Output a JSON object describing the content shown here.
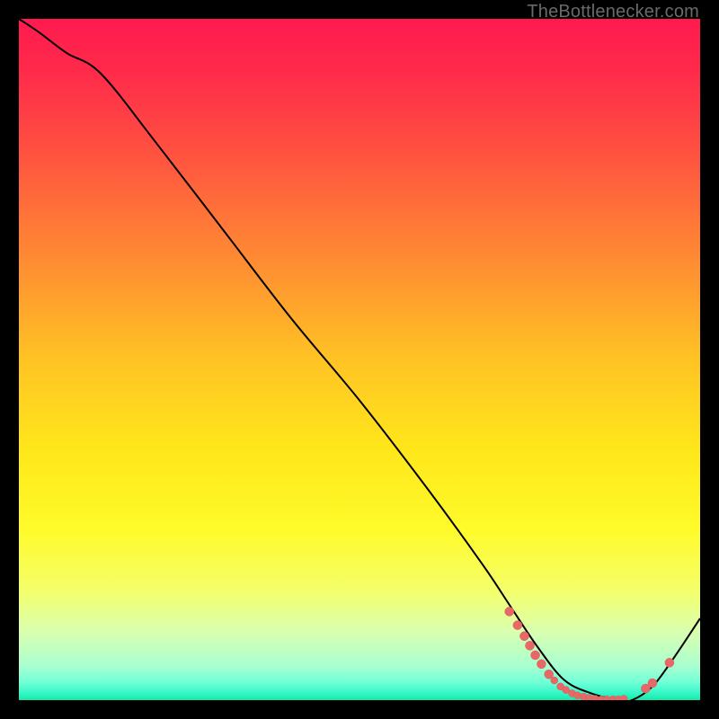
{
  "watermark": "TheBottlenecker.com",
  "colors": {
    "black": "#000000",
    "curve": "#000000",
    "marker_fill": "#e86868",
    "marker_stroke": "#d85a5a",
    "gradient_stops": [
      {
        "offset": 0.0,
        "color": "#ff1a4e"
      },
      {
        "offset": 0.08,
        "color": "#ff2b4a"
      },
      {
        "offset": 0.2,
        "color": "#ff5340"
      },
      {
        "offset": 0.35,
        "color": "#ff8a33"
      },
      {
        "offset": 0.5,
        "color": "#ffc324"
      },
      {
        "offset": 0.63,
        "color": "#ffe61b"
      },
      {
        "offset": 0.75,
        "color": "#fffb2a"
      },
      {
        "offset": 0.84,
        "color": "#f4ff6b"
      },
      {
        "offset": 0.9,
        "color": "#d9ffb0"
      },
      {
        "offset": 0.95,
        "color": "#a9ffd0"
      },
      {
        "offset": 0.975,
        "color": "#6dffd7"
      },
      {
        "offset": 0.99,
        "color": "#33f7c6"
      },
      {
        "offset": 1.0,
        "color": "#18e8a8"
      }
    ]
  },
  "chart_data": {
    "type": "line",
    "title": "",
    "xlabel": "",
    "ylabel": "",
    "xlim": [
      0,
      100
    ],
    "ylim": [
      0,
      100
    ],
    "series": [
      {
        "name": "bottleneck-curve",
        "x": [
          0,
          3,
          7,
          12,
          20,
          30,
          40,
          50,
          60,
          68,
          72,
          76,
          80,
          84,
          88,
          90,
          93,
          96,
          100
        ],
        "y": [
          100,
          98,
          95,
          92,
          82,
          69,
          56,
          44,
          31,
          20,
          14,
          8,
          3,
          1,
          0,
          0,
          2,
          6,
          12
        ]
      }
    ],
    "markers": {
      "name": "highlighted-points",
      "points": [
        {
          "x": 72.0,
          "y": 13.0,
          "r": 5
        },
        {
          "x": 73.2,
          "y": 11.0,
          "r": 5
        },
        {
          "x": 74.2,
          "y": 9.4,
          "r": 5
        },
        {
          "x": 75.0,
          "y": 8.0,
          "r": 5
        },
        {
          "x": 75.8,
          "y": 6.6,
          "r": 5
        },
        {
          "x": 76.7,
          "y": 5.3,
          "r": 5
        },
        {
          "x": 77.8,
          "y": 3.8,
          "r": 5
        },
        {
          "x": 78.6,
          "y": 2.9,
          "r": 4
        },
        {
          "x": 79.5,
          "y": 2.0,
          "r": 4
        },
        {
          "x": 80.3,
          "y": 1.5,
          "r": 4
        },
        {
          "x": 81.2,
          "y": 1.0,
          "r": 4
        },
        {
          "x": 82.0,
          "y": 0.7,
          "r": 4
        },
        {
          "x": 82.9,
          "y": 0.5,
          "r": 4
        },
        {
          "x": 83.7,
          "y": 0.3,
          "r": 4
        },
        {
          "x": 84.6,
          "y": 0.2,
          "r": 4
        },
        {
          "x": 85.5,
          "y": 0.1,
          "r": 4
        },
        {
          "x": 86.3,
          "y": 0.1,
          "r": 4
        },
        {
          "x": 87.2,
          "y": 0.1,
          "r": 4
        },
        {
          "x": 88.0,
          "y": 0.1,
          "r": 4
        },
        {
          "x": 88.8,
          "y": 0.2,
          "r": 4
        },
        {
          "x": 92.0,
          "y": 1.7,
          "r": 5
        },
        {
          "x": 93.0,
          "y": 2.5,
          "r": 5
        },
        {
          "x": 95.5,
          "y": 5.5,
          "r": 5
        }
      ]
    }
  }
}
